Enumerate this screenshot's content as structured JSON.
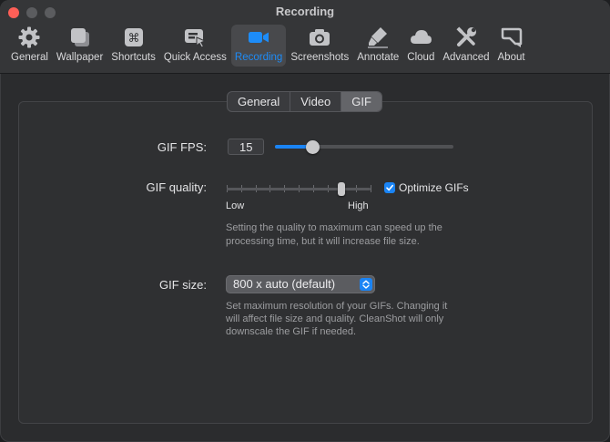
{
  "window": {
    "title": "Recording",
    "traffic_lights": [
      "close",
      "minimize",
      "maximize"
    ]
  },
  "toolbar": {
    "items": [
      {
        "label": "General",
        "icon": "gear-icon"
      },
      {
        "label": "Wallpaper",
        "icon": "wallpaper-icon"
      },
      {
        "label": "Shortcuts",
        "icon": "command-key-icon"
      },
      {
        "label": "Quick Access",
        "icon": "quick-access-icon"
      },
      {
        "label": "Recording",
        "icon": "video-camera-icon",
        "active": true
      },
      {
        "label": "Screenshots",
        "icon": "camera-icon"
      },
      {
        "label": "Annotate",
        "icon": "highlighter-icon"
      },
      {
        "label": "Cloud",
        "icon": "cloud-icon"
      },
      {
        "label": "Advanced",
        "icon": "tools-icon"
      },
      {
        "label": "About",
        "icon": "about-icon"
      }
    ]
  },
  "tabs": {
    "items": [
      "General",
      "Video",
      "GIF"
    ],
    "selected": "GIF"
  },
  "gif_fps": {
    "label": "GIF FPS:",
    "value": "15",
    "slider_fraction": 0.21
  },
  "gif_quality": {
    "label": "GIF quality:",
    "low_label": "Low",
    "high_label": "High",
    "tick_count": 11,
    "slider_fraction": 0.8,
    "help": [
      "Setting the quality to maximum can speed up the",
      "processing time, but it will increase file size."
    ]
  },
  "optimize": {
    "label": "Optimize GIFs",
    "checked": true
  },
  "gif_size": {
    "label": "GIF size:",
    "selected": "800 x auto (default)",
    "help": [
      "Set maximum resolution of your GIFs. Changing it",
      "will affect file size and quality. CleanShot will only",
      "downscale the GIF if needed."
    ]
  },
  "colors": {
    "accent": "#1a84f5",
    "close_button": "#fe5f57",
    "window_bg": "#2b2c2e"
  }
}
